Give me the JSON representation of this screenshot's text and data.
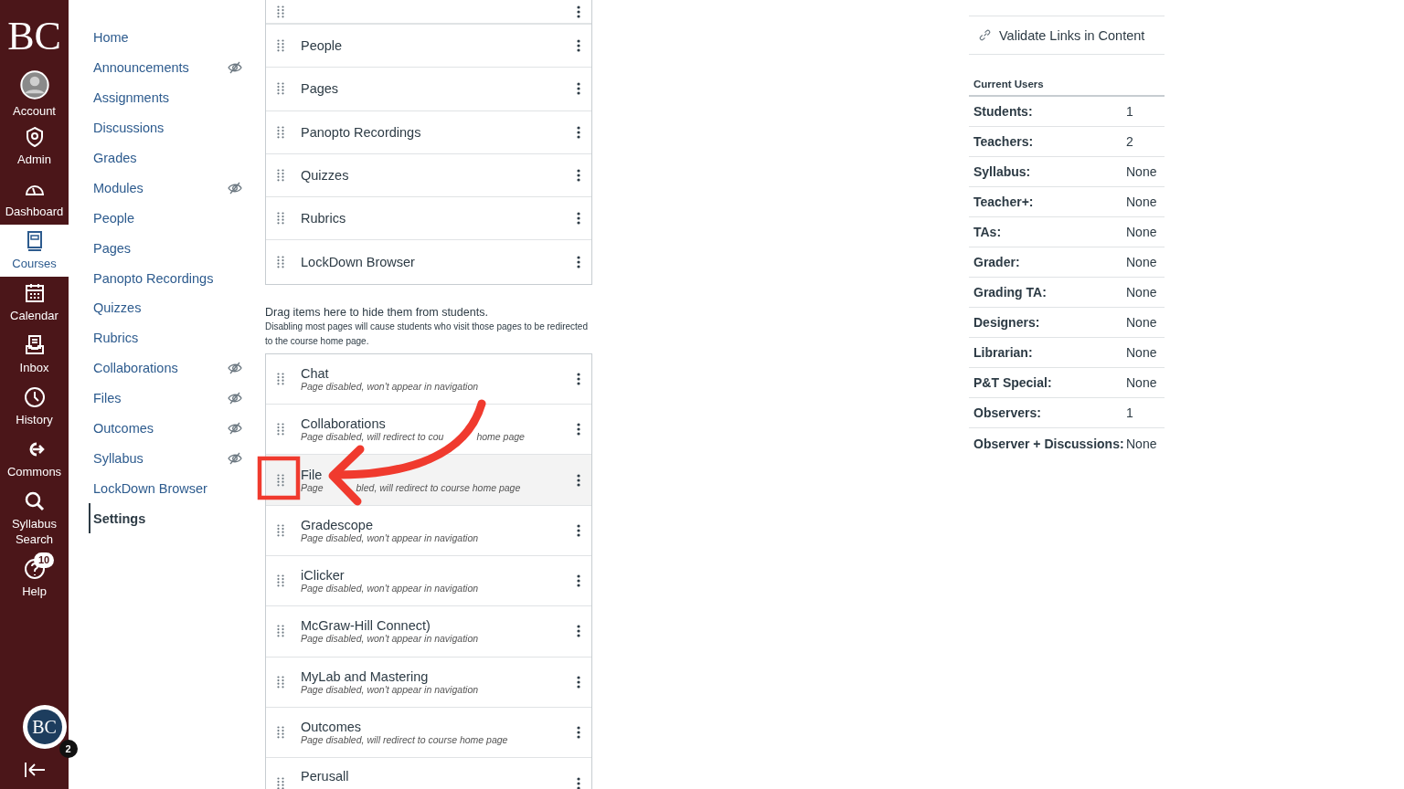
{
  "global_nav": {
    "logo": "BC",
    "items": [
      {
        "label": "Account",
        "selected": false
      },
      {
        "label": "Admin",
        "selected": false
      },
      {
        "label": "Dashboard",
        "selected": false
      },
      {
        "label": "Courses",
        "selected": true
      },
      {
        "label": "Calendar",
        "selected": false
      },
      {
        "label": "Inbox",
        "selected": false
      },
      {
        "label": "History",
        "selected": false
      },
      {
        "label": "Commons",
        "selected": false
      },
      {
        "label": "Syllabus Search",
        "selected": false
      },
      {
        "label": "Help",
        "selected": false,
        "badge": "10"
      }
    ],
    "profile": {
      "initials": "BC",
      "badge": "2"
    }
  },
  "course_nav": [
    {
      "label": "Home",
      "hidden": false,
      "selected": false
    },
    {
      "label": "Announcements",
      "hidden": true,
      "selected": false
    },
    {
      "label": "Assignments",
      "hidden": false,
      "selected": false
    },
    {
      "label": "Discussions",
      "hidden": false,
      "selected": false
    },
    {
      "label": "Grades",
      "hidden": false,
      "selected": false
    },
    {
      "label": "Modules",
      "hidden": true,
      "selected": false
    },
    {
      "label": "People",
      "hidden": false,
      "selected": false
    },
    {
      "label": "Pages",
      "hidden": false,
      "selected": false
    },
    {
      "label": "Panopto Recordings",
      "hidden": false,
      "selected": false
    },
    {
      "label": "Quizzes",
      "hidden": false,
      "selected": false
    },
    {
      "label": "Rubrics",
      "hidden": false,
      "selected": false
    },
    {
      "label": "Collaborations",
      "hidden": true,
      "selected": false
    },
    {
      "label": "Files",
      "hidden": true,
      "selected": false
    },
    {
      "label": "Outcomes",
      "hidden": true,
      "selected": false
    },
    {
      "label": "Syllabus",
      "hidden": true,
      "selected": false
    },
    {
      "label": "LockDown Browser",
      "hidden": false,
      "selected": false
    },
    {
      "label": "Settings",
      "hidden": false,
      "selected": true
    }
  ],
  "enabled_items": [
    {
      "label": "People"
    },
    {
      "label": "Pages"
    },
    {
      "label": "Panopto Recordings"
    },
    {
      "label": "Quizzes"
    },
    {
      "label": "Rubrics"
    },
    {
      "label": "LockDown Browser"
    }
  ],
  "disabled_intro": {
    "title": "Drag items here to hide them from students.",
    "note": "Disabling most pages will cause students who visit those pages to be redirected to the course home page."
  },
  "disabled_items": [
    {
      "label": "Chat",
      "note": [
        "Page disabled, won't appear in navigation"
      ],
      "highlighted": false
    },
    {
      "label": "Collaborations",
      "note": [
        "Page disabled, will redirect to cou",
        "home page"
      ],
      "highlighted": false
    },
    {
      "label": "File",
      "note": [
        "Page",
        "bled, will redirect to course home page"
      ],
      "highlighted": true
    },
    {
      "label": "Gradescope",
      "note": [
        "Page disabled, won't appear in navigation"
      ],
      "highlighted": false
    },
    {
      "label": "iClicker",
      "note": [
        "Page disabled, won't appear in navigation"
      ],
      "highlighted": false
    },
    {
      "label": "McGraw-Hill Connect)",
      "note": [
        "Page disabled, won't appear in navigation"
      ],
      "highlighted": false
    },
    {
      "label": "MyLab and Mastering",
      "note": [
        "Page disabled, won't appear in navigation"
      ],
      "highlighted": false
    },
    {
      "label": "Outcomes",
      "note": [
        "Page disabled, will redirect to course home page"
      ],
      "highlighted": false
    },
    {
      "label": "Perusall",
      "highlighted": false
    }
  ],
  "sidebar": {
    "validate_button": "Validate Links in Content",
    "users_heading": "Current Users",
    "users": [
      {
        "role": "Students:",
        "count": "1"
      },
      {
        "role": "Teachers:",
        "count": "2"
      },
      {
        "role": "Syllabus:",
        "count": "None"
      },
      {
        "role": "Teacher+:",
        "count": "None"
      },
      {
        "role": "TAs:",
        "count": "None"
      },
      {
        "role": "Grader:",
        "count": "None"
      },
      {
        "role": "Grading TA:",
        "count": "None"
      },
      {
        "role": "Designers:",
        "count": "None"
      },
      {
        "role": "Librarian:",
        "count": "None"
      },
      {
        "role": "P&T Special:",
        "count": "None"
      },
      {
        "role": "Observers:",
        "count": "1"
      },
      {
        "role": "Observer + Discussions:",
        "count": "None"
      }
    ]
  }
}
